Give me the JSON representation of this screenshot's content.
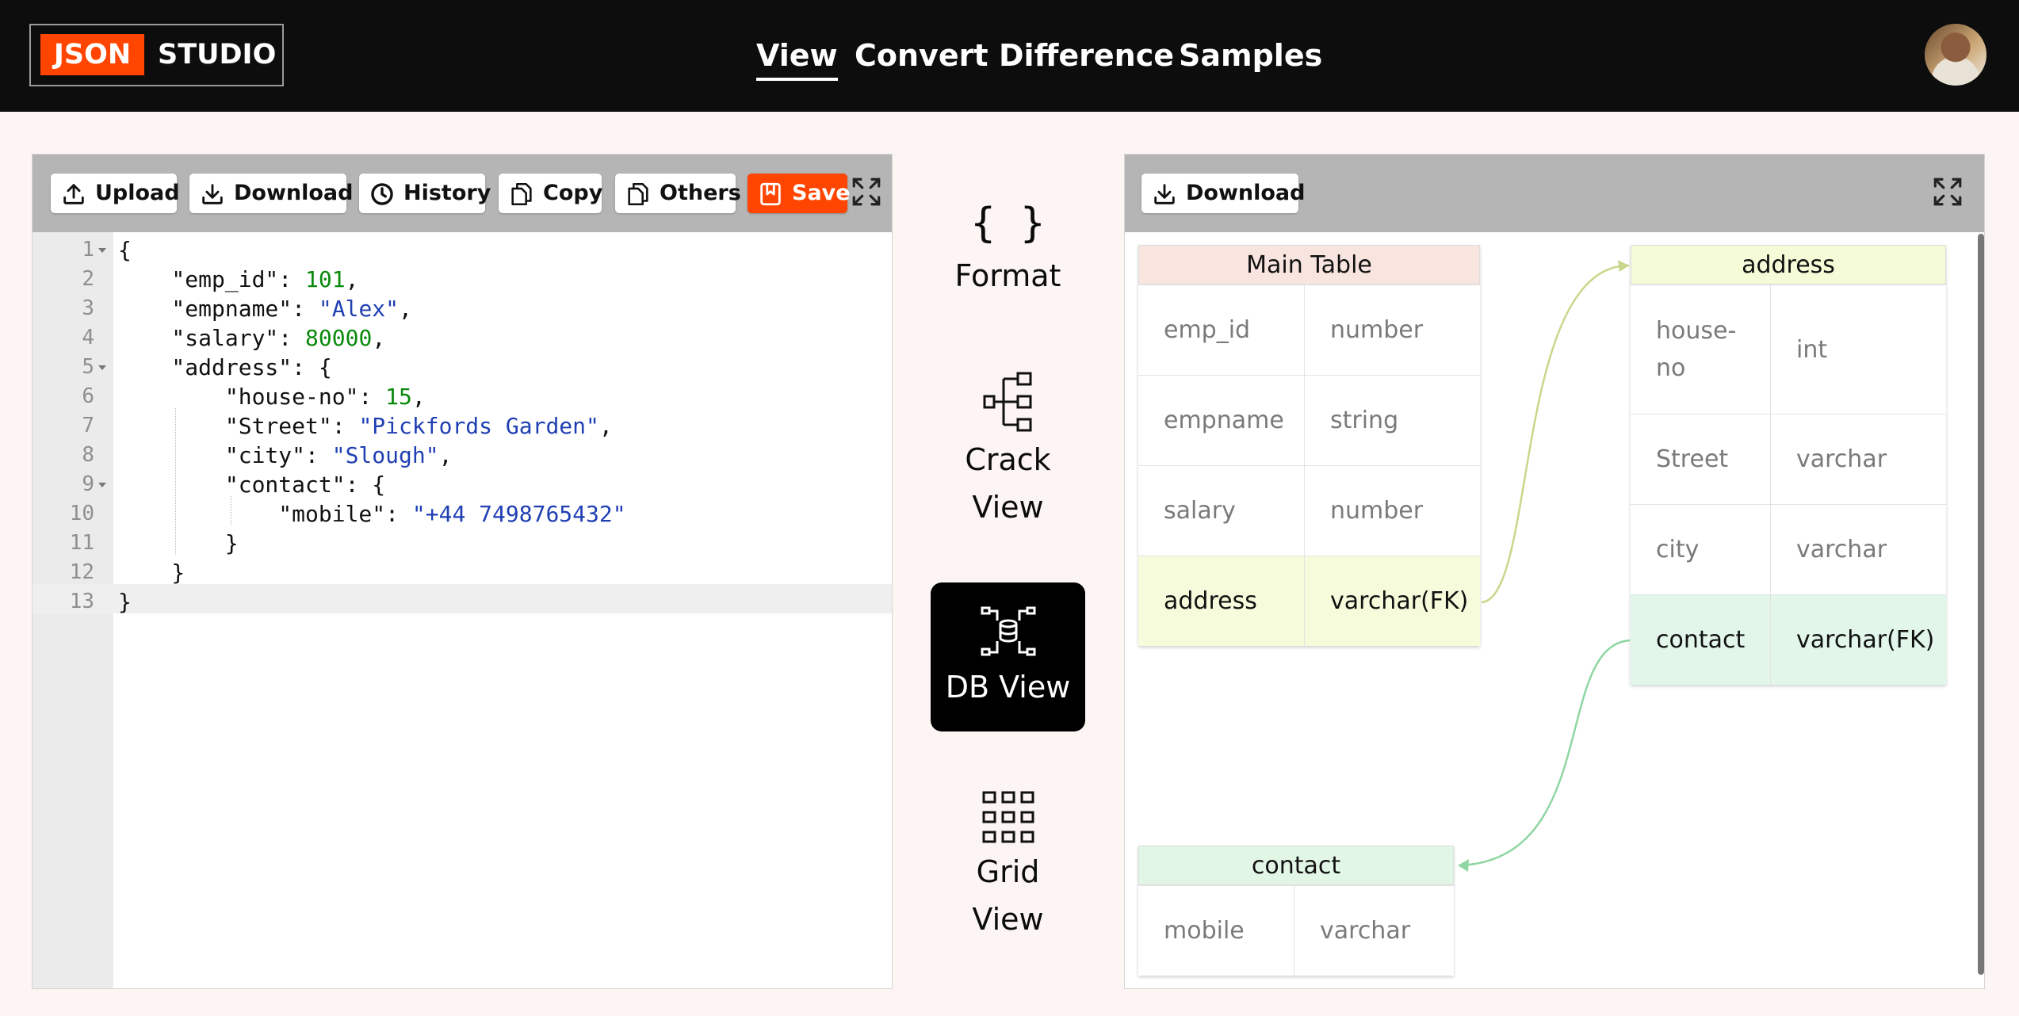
{
  "app": {
    "logo_json": "JSON",
    "logo_studio": "STUDIO",
    "nav": [
      {
        "label": "View",
        "active": true
      },
      {
        "label": "Convert",
        "active": false
      },
      {
        "label": "Difference",
        "active": false
      },
      {
        "label": "Samples",
        "active": false
      }
    ]
  },
  "editor": {
    "toolbar": {
      "upload": "Upload",
      "download": "Download",
      "history": "History",
      "copy": "Copy",
      "others": "Others",
      "save": "Save"
    },
    "line_numbers": [
      "1",
      "2",
      "3",
      "4",
      "5",
      "6",
      "7",
      "8",
      "9",
      "10",
      "11",
      "12",
      "13"
    ],
    "lines": [
      "{",
      "    \"emp_id\": 101,",
      "    \"empname\": \"Alex\",",
      "    \"salary\": 80000,",
      "    \"address\": {",
      "        \"house-no\": 15,",
      "        \"Street\": \"Pickfords Garden\",",
      "        \"city\": \"Slough\",",
      "        \"contact\": {",
      "            \"mobile\": \"+44 7498765432\"",
      "        }",
      "    }",
      "}"
    ],
    "active_line": 13
  },
  "views": {
    "format": {
      "glyph": "{ }",
      "label": "Format"
    },
    "crack": {
      "label_1": "Crack",
      "label_2": "View"
    },
    "db": {
      "label": "DB View",
      "active": true
    },
    "grid": {
      "label_1": "Grid",
      "label_2": "View"
    }
  },
  "db_view": {
    "download": "Download",
    "tables": {
      "main": {
        "title": "Main Table",
        "rows": [
          [
            "emp_id",
            "number"
          ],
          [
            "empname",
            "string"
          ],
          [
            "salary",
            "number"
          ],
          [
            "address",
            "varchar(FK)"
          ]
        ]
      },
      "address": {
        "title": "address",
        "rows": [
          [
            "house-\nno",
            "int"
          ],
          [
            "Street",
            "varchar"
          ],
          [
            "city",
            "varchar"
          ],
          [
            "contact",
            "varchar(FK)"
          ]
        ]
      },
      "contact": {
        "title": "contact",
        "rows": [
          [
            "mobile",
            "varchar"
          ]
        ]
      }
    },
    "colors": {
      "main_header": "#f9e5df",
      "address_header": "#f4fbd6",
      "contact_header": "#e2f6e6",
      "fk_yellow": "#f6fcdb",
      "fk_green": "#e2f7ea",
      "accent": "#ff4500"
    }
  }
}
